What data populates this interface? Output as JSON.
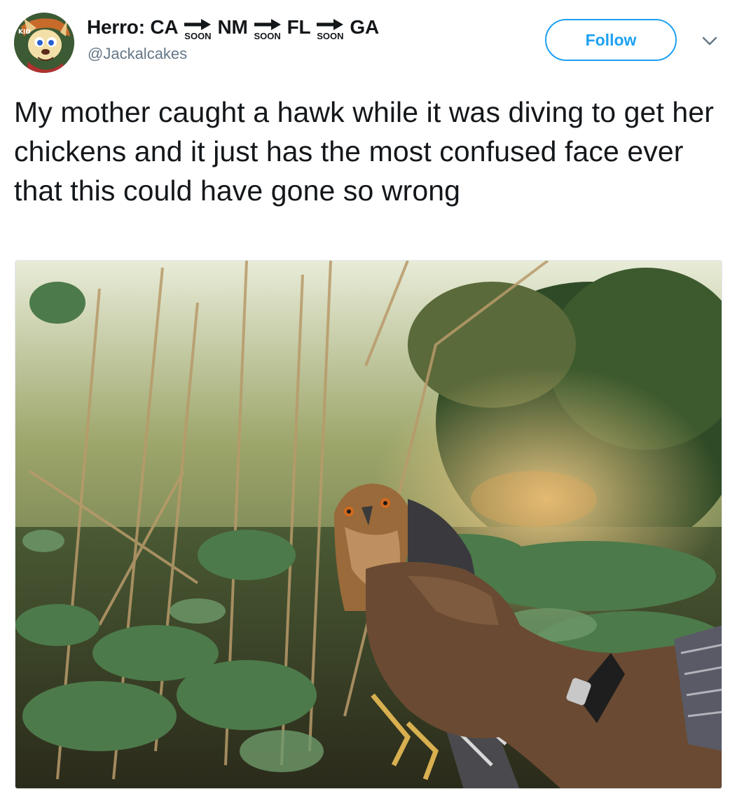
{
  "user": {
    "name_parts": [
      "Herro: CA",
      "NM",
      "FL",
      "GA"
    ],
    "soon_label": "SOON",
    "handle": "@Jackalcakes"
  },
  "follow_label": "Follow",
  "tweet_text": "My mother caught a hawk while it was diving to get her chickens and it just has the most confused face ever that this could have gone so wrong",
  "colors": {
    "accent": "#1da1f2",
    "text": "#14171a",
    "muted": "#657786"
  },
  "icons": {
    "arrow": "right-arrow-icon",
    "menu": "chevron-down-icon"
  }
}
